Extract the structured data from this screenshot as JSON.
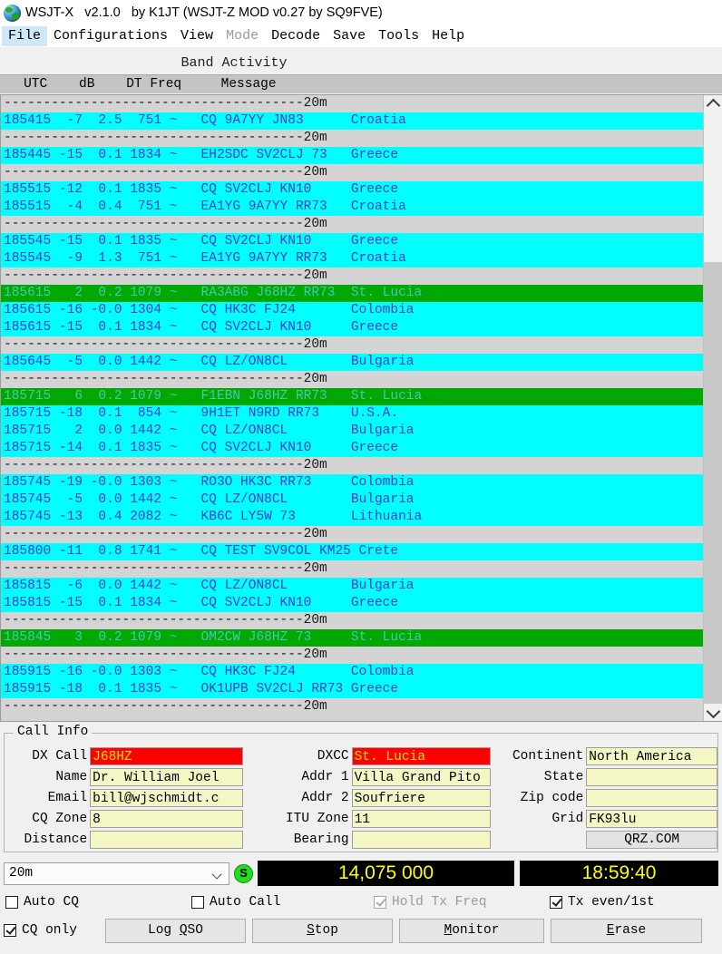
{
  "window": {
    "icon": "globe-icon",
    "title": "WSJT-X   v2.1.0   by K1JT (WSJT-Z MOD v0.27 by SQ9FVE)"
  },
  "menubar": {
    "items": [
      {
        "label": "File",
        "state": "selected"
      },
      {
        "label": "Configurations",
        "state": "normal"
      },
      {
        "label": "View",
        "state": "normal"
      },
      {
        "label": "Mode",
        "state": "disabled"
      },
      {
        "label": "Decode",
        "state": "normal"
      },
      {
        "label": "Save",
        "state": "normal"
      },
      {
        "label": "Tools",
        "state": "normal"
      },
      {
        "label": "Help",
        "state": "normal"
      }
    ]
  },
  "band_activity": {
    "title": "Band Activity",
    "header": "   UTC    dB    DT Freq     Message",
    "separator_text": "--------------------------------------20m",
    "rows": [
      {
        "type": "sep",
        "text": "--------------------------------------20m"
      },
      {
        "type": "cyan",
        "text": "185415  -7  2.5  751 ~   CQ 9A7YY JN83      Croatia"
      },
      {
        "type": "sep",
        "text": "--------------------------------------20m"
      },
      {
        "type": "cyan",
        "text": "185445 -15  0.1 1834 ~   EH2SDC SV2CLJ 73   Greece"
      },
      {
        "type": "sep",
        "text": "--------------------------------------20m"
      },
      {
        "type": "cyan",
        "text": "185515 -12  0.1 1835 ~   CQ SV2CLJ KN10     Greece"
      },
      {
        "type": "cyan",
        "text": "185515  -4  0.4  751 ~   EA1YG 9A7YY RR73   Croatia"
      },
      {
        "type": "sep",
        "text": "--------------------------------------20m"
      },
      {
        "type": "cyan",
        "text": "185545 -15  0.1 1835 ~   CQ SV2CLJ KN10     Greece"
      },
      {
        "type": "cyan",
        "text": "185545  -9  1.3  751 ~   EA1YG 9A7YY RR73   Croatia"
      },
      {
        "type": "sep",
        "text": "--------------------------------------20m"
      },
      {
        "type": "green",
        "text": "185615   2  0.2 1079 ~   RA3ABG J68HZ RR73  St. Lucia"
      },
      {
        "type": "cyan",
        "text": "185615 -16 -0.0 1304 ~   CQ HK3C FJ24       Colombia"
      },
      {
        "type": "cyan",
        "text": "185615 -15  0.1 1834 ~   CQ SV2CLJ KN10     Greece"
      },
      {
        "type": "sep",
        "text": "--------------------------------------20m"
      },
      {
        "type": "cyan",
        "text": "185645  -5  0.0 1442 ~   CQ LZ/ON8CL        Bulgaria"
      },
      {
        "type": "sep",
        "text": "--------------------------------------20m"
      },
      {
        "type": "green",
        "text": "185715   6  0.2 1079 ~   F1EBN J68HZ RR73   St. Lucia"
      },
      {
        "type": "cyan",
        "text": "185715 -18  0.1  854 ~   9H1ET N9RD RR73    U.S.A."
      },
      {
        "type": "cyan",
        "text": "185715   2  0.0 1442 ~   CQ LZ/ON8CL        Bulgaria"
      },
      {
        "type": "cyan",
        "text": "185715 -14  0.1 1835 ~   CQ SV2CLJ KN10     Greece"
      },
      {
        "type": "sep",
        "text": "--------------------------------------20m"
      },
      {
        "type": "cyan",
        "text": "185745 -19 -0.0 1303 ~   RO3O HK3C RR73     Colombia"
      },
      {
        "type": "cyan",
        "text": "185745  -5  0.0 1442 ~   CQ LZ/ON8CL        Bulgaria"
      },
      {
        "type": "cyan",
        "text": "185745 -13  0.4 2082 ~   KB6C LY5W 73       Lithuania"
      },
      {
        "type": "sep",
        "text": "--------------------------------------20m"
      },
      {
        "type": "cyan",
        "text": "185800 -11  0.8 1741 ~   CQ TEST SV9COL KM25 Crete"
      },
      {
        "type": "sep",
        "text": "--------------------------------------20m"
      },
      {
        "type": "cyan",
        "text": "185815  -6  0.0 1442 ~   CQ LZ/ON8CL        Bulgaria"
      },
      {
        "type": "cyan",
        "text": "185815 -15  0.1 1834 ~   CQ SV2CLJ KN10     Greece"
      },
      {
        "type": "sep",
        "text": "--------------------------------------20m"
      },
      {
        "type": "green",
        "text": "185845   3  0.2 1079 ~   OM2CW J68HZ 73     St. Lucia"
      },
      {
        "type": "sep",
        "text": "--------------------------------------20m"
      },
      {
        "type": "cyan",
        "text": "185915 -16 -0.0 1303 ~   CQ HK3C FJ24       Colombia"
      },
      {
        "type": "cyan",
        "text": "185915 -18  0.1 1835 ~   OK1UPB SV2CLJ RR73 Greece"
      },
      {
        "type": "sep",
        "text": "--------------------------------------20m"
      }
    ]
  },
  "call_info": {
    "legend": "Call Info",
    "fields": {
      "dx_call": {
        "label": "DX Call",
        "value": "J68HZ",
        "style": "alert"
      },
      "dxcc": {
        "label": "DXCC",
        "value": "St. Lucia",
        "style": "alert"
      },
      "continent": {
        "label": "Continent",
        "value": "North America",
        "style": "normal"
      },
      "name": {
        "label": "Name",
        "value": "Dr. William Joel",
        "style": "normal"
      },
      "addr1": {
        "label": "Addr 1",
        "value": "Villa Grand Pito",
        "style": "normal"
      },
      "state": {
        "label": "State",
        "value": "",
        "style": "normal"
      },
      "email": {
        "label": "Email",
        "value": "bill@wjschmidt.c",
        "style": "normal"
      },
      "addr2": {
        "label": "Addr 2",
        "value": "Soufriere",
        "style": "normal"
      },
      "zip": {
        "label": "Zip code",
        "value": "",
        "style": "normal"
      },
      "cq_zone": {
        "label": "CQ Zone",
        "value": "8",
        "style": "normal"
      },
      "itu_zone": {
        "label": "ITU Zone",
        "value": "11",
        "style": "normal"
      },
      "grid": {
        "label": "Grid",
        "value": "FK93lu",
        "style": "normal"
      },
      "distance": {
        "label": "Distance",
        "value": "",
        "style": "normal"
      },
      "bearing": {
        "label": "Bearing",
        "value": "",
        "style": "normal"
      },
      "qrz_button": {
        "label": "QRZ.COM"
      }
    }
  },
  "bottom": {
    "band_select": {
      "value": "20m",
      "icon": "chevron-down-icon"
    },
    "status_indicator": {
      "label": "S",
      "color": "#22dd22"
    },
    "frequency": "14,075 000",
    "clock": "18:59:40",
    "lcd_color": "#ffff00",
    "checkboxes": [
      {
        "label": "Auto CQ",
        "checked": false,
        "enabled": true
      },
      {
        "label": "Auto Call",
        "checked": false,
        "enabled": true
      },
      {
        "label": "Hold Tx Freq",
        "checked": true,
        "enabled": false
      },
      {
        "label": "Tx even/1st",
        "checked": true,
        "enabled": true
      },
      {
        "label": "CQ only",
        "checked": true,
        "enabled": true
      }
    ],
    "buttons": [
      {
        "label": "Log QSO",
        "mnemonic_index": 4
      },
      {
        "label": "Stop",
        "mnemonic_index": 0
      },
      {
        "label": "Monitor",
        "mnemonic_index": 0
      },
      {
        "label": "Erase",
        "mnemonic_index": 0
      }
    ]
  }
}
